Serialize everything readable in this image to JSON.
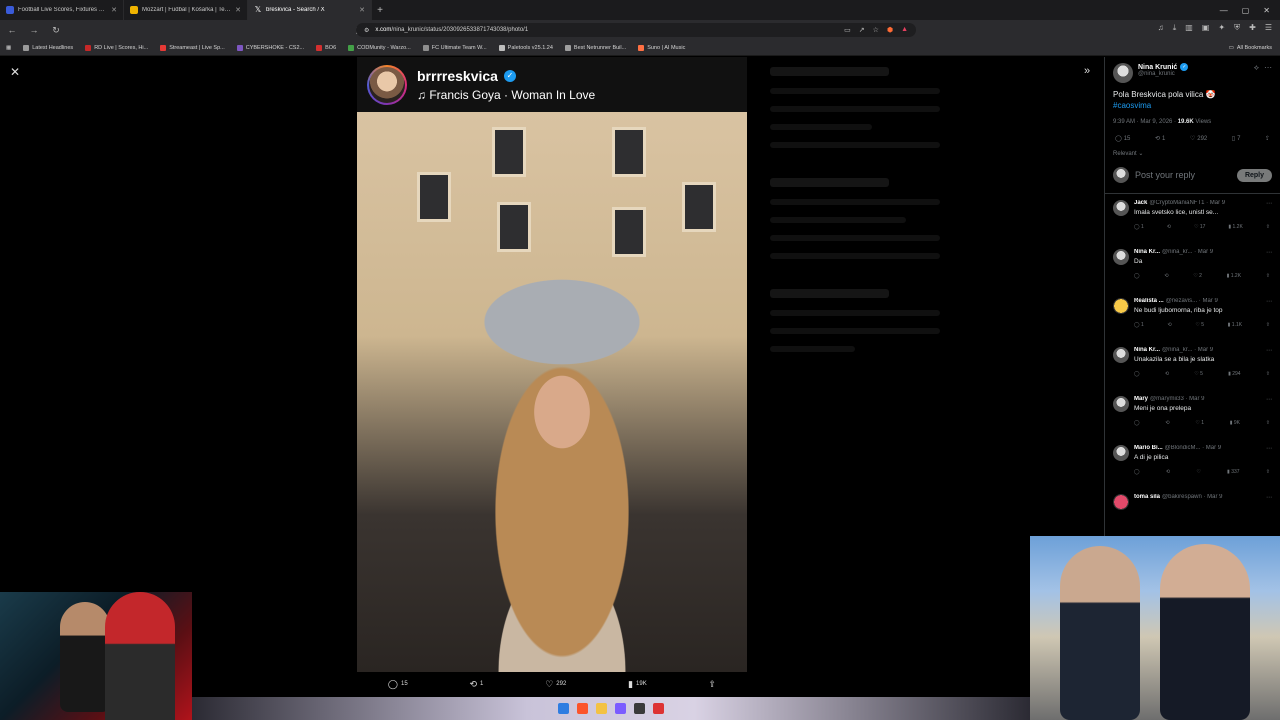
{
  "tabs": [
    {
      "title": "Football Live Scores, Fixtures & Odds",
      "color": "#3a5bd9"
    },
    {
      "title": "Mozzart | Fudbal | Košarka | Tenis | Hokej",
      "color": "#f0b400"
    },
    {
      "title": "breskvica - Search / X",
      "color": "#000000",
      "active": true
    }
  ],
  "url": {
    "host": "x.com",
    "path": "/nina_krunic/status/2030926533871743038/photo/1"
  },
  "bookmarks": [
    {
      "label": "Latest Headlines",
      "color": "#9a9a9a"
    },
    {
      "label": "RD Live | Scores, Hi...",
      "color": "#c62828"
    },
    {
      "label": "Streameast | Live Sp...",
      "color": "#e53935"
    },
    {
      "label": "CYBERSHOKE - CS2...",
      "color": "#7e57c2"
    },
    {
      "label": "BO6",
      "color": "#d32f2f"
    },
    {
      "label": "CODMunity - Warzo...",
      "color": "#43a047"
    },
    {
      "label": "FC Ultimate Team W...",
      "color": "#8e8e8e"
    },
    {
      "label": "Paletools v25.1.24",
      "color": "#bdbdbd"
    },
    {
      "label": "Best Netrunner Buil...",
      "color": "#9e9e9e"
    },
    {
      "label": "Suno | AI Music",
      "color": "#ff7043"
    }
  ],
  "all_bookmarks": "All Bookmarks",
  "media": {
    "username": "brrrreskvica",
    "song": "Francis Goya · Woman In Love",
    "actions": {
      "replies": "15",
      "reposts": "1",
      "likes": "292",
      "views": "19K"
    }
  },
  "post": {
    "author": "Nina Krunić",
    "handle": "@nina_krunic",
    "text": "Pola Breskvica pola vilica 🤡",
    "hashtag": "#caosvima",
    "time": "9:39 AM · Mar 9, 2026 · ",
    "views": "19.6K",
    "views_label": " Views",
    "stats": {
      "replies": "15",
      "reposts": "1",
      "likes": "292",
      "bookmarks": "7"
    },
    "sort": "Relevant ⌄",
    "reply_placeholder": "Post your reply",
    "reply_button": "Reply"
  },
  "comments": [
    {
      "name": "Jack",
      "handle": "@CryptoManiaNFT1 · Mar 9",
      "text": "Imala svetsko lice, unistl se...",
      "replies": "1",
      "reposts": "",
      "likes": "17",
      "views": "1.2K"
    },
    {
      "name": "Nina Kr...",
      "handle": "@nina_kr... · Mar 9",
      "text": "Da",
      "replies": "",
      "reposts": "",
      "likes": "2",
      "views": "1.2K"
    },
    {
      "name": "Realista ...",
      "handle": "@nezavis... · Mar 9",
      "text": "Ne budi ljubomorna, riba je top",
      "replies": "1",
      "reposts": "",
      "likes": "5",
      "views": "1.1K"
    },
    {
      "name": "Nina Kr...",
      "handle": "@nina_kr... · Mar 9",
      "text": "Unakazila se a bila je slatka",
      "replies": "",
      "reposts": "",
      "likes": "5",
      "views": "294"
    },
    {
      "name": "Mary",
      "handle": "@marymii33 · Mar 9",
      "text": "Meni je ona prelepa",
      "replies": "",
      "reposts": "",
      "likes": "1",
      "views": "9K"
    },
    {
      "name": "Mario Bi...",
      "handle": "@BlondicM... · Mar 9",
      "text": "A di je pilica",
      "replies": "",
      "reposts": "",
      "likes": "",
      "views": "337"
    },
    {
      "name": "toma sila",
      "handle": "@bakirespawn · Mar 9",
      "text": "",
      "replies": "",
      "reposts": "",
      "likes": "",
      "views": ""
    }
  ]
}
